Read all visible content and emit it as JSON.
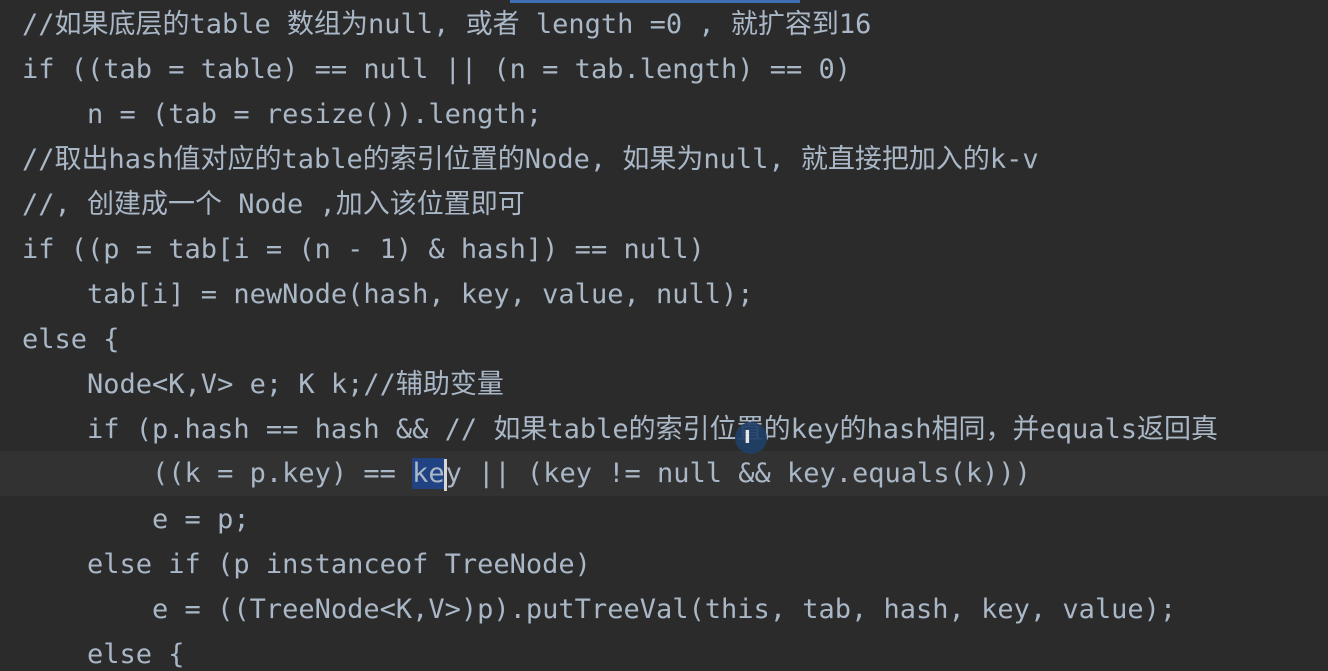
{
  "editor": {
    "lines": [
      "//如果底层的table 数组为null, 或者 length =0 , 就扩容到16",
      "if ((tab = table) == null || (n = tab.length) == 0)",
      "    n = (tab = resize()).length;",
      "//取出hash值对应的table的索引位置的Node, 如果为null, 就直接把加入的k-v",
      "//, 创建成一个 Node ,加入该位置即可",
      "if ((p = tab[i = (n - 1) & hash]) == null)",
      "    tab[i] = newNode(hash, key, value, null);",
      "else {",
      "    Node<K,V> e; K k;//辅助变量",
      "    if (p.hash == hash && // 如果table的索引位置的key的hash相同，并equals返回真",
      "        ((k = p.key) == ",
      "        e = p;",
      "    else if (p instanceof TreeNode)",
      "        e = ((TreeNode<K,V>)p).putTreeVal(this, tab, hash, key, value);",
      "    else {"
    ],
    "current_line": {
      "selected": "ke",
      "after_caret": "y || (key != null && key.equals(k)))"
    },
    "mouse_cursor_icon": "text-cursor-icon"
  }
}
